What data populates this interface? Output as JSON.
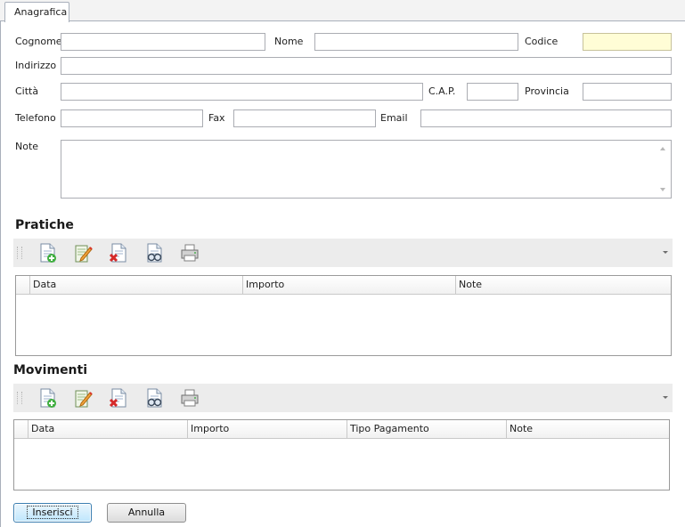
{
  "tab": {
    "label": "Anagrafica"
  },
  "form": {
    "cognome": {
      "label": "Cognome",
      "value": ""
    },
    "nome": {
      "label": "Nome",
      "value": ""
    },
    "codice": {
      "label": "Codice",
      "value": ""
    },
    "indirizzo": {
      "label": "Indirizzo",
      "value": ""
    },
    "citta": {
      "label": "Città",
      "value": ""
    },
    "cap": {
      "label": "C.A.P.",
      "value": ""
    },
    "provincia": {
      "label": "Provincia",
      "value": ""
    },
    "telefono": {
      "label": "Telefono",
      "value": ""
    },
    "fax": {
      "label": "Fax",
      "value": ""
    },
    "email": {
      "label": "Email",
      "value": ""
    },
    "note": {
      "label": "Note",
      "value": ""
    }
  },
  "pratiche": {
    "title": "Pratiche",
    "toolbar": [
      "add-document-icon",
      "edit-document-icon",
      "delete-document-icon",
      "view-document-icon",
      "print-icon"
    ],
    "columns": [
      "Data",
      "Importo",
      "Note"
    ],
    "rows": []
  },
  "movimenti": {
    "title": "Movimenti",
    "toolbar": [
      "add-document-icon",
      "edit-document-icon",
      "delete-document-icon",
      "view-document-icon",
      "print-icon"
    ],
    "columns": [
      "Data",
      "Importo",
      "Tipo Pagamento",
      "Note"
    ],
    "rows": []
  },
  "actions": {
    "insert_label": "Inserisci",
    "cancel_label": "Annulla"
  },
  "colors": {
    "highlight_field": "#fffdd6",
    "toolbar_bg": "#ececec",
    "default_button": "#bee6fd"
  }
}
